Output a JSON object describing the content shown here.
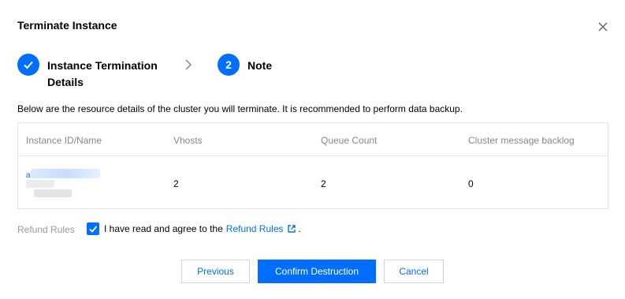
{
  "dialog": {
    "title": "Terminate Instance",
    "close_icon": "close-icon"
  },
  "steps": [
    {
      "number": "1",
      "icon": "check-icon",
      "label": "Instance Termination Details",
      "state": "completed"
    },
    {
      "number": "2",
      "label": "Note",
      "state": "active"
    }
  ],
  "step_separator_icon": "chevron-right-icon",
  "description": "Below are the resource details of the cluster you will terminate. It is recommended to perform data backup.",
  "table": {
    "columns": [
      "Instance ID/Name",
      "Vhosts",
      "Queue Count",
      "Cluster message backlog"
    ],
    "rows": [
      {
        "instance_id": "a",
        "vhosts": "2",
        "queue_count": "2",
        "backlog": "0"
      }
    ]
  },
  "refund": {
    "label": "Refund Rules",
    "agree_text": "I have read and agree to the",
    "link_text": "Refund Rules",
    "link_icon": "external-link-icon",
    "trailing": ".",
    "checked": true
  },
  "buttons": {
    "previous": "Previous",
    "confirm": "Confirm Destruction",
    "cancel": "Cancel"
  },
  "colors": {
    "accent": "#006eff",
    "muted_text": "#888888",
    "border": "#e5e5e5"
  }
}
